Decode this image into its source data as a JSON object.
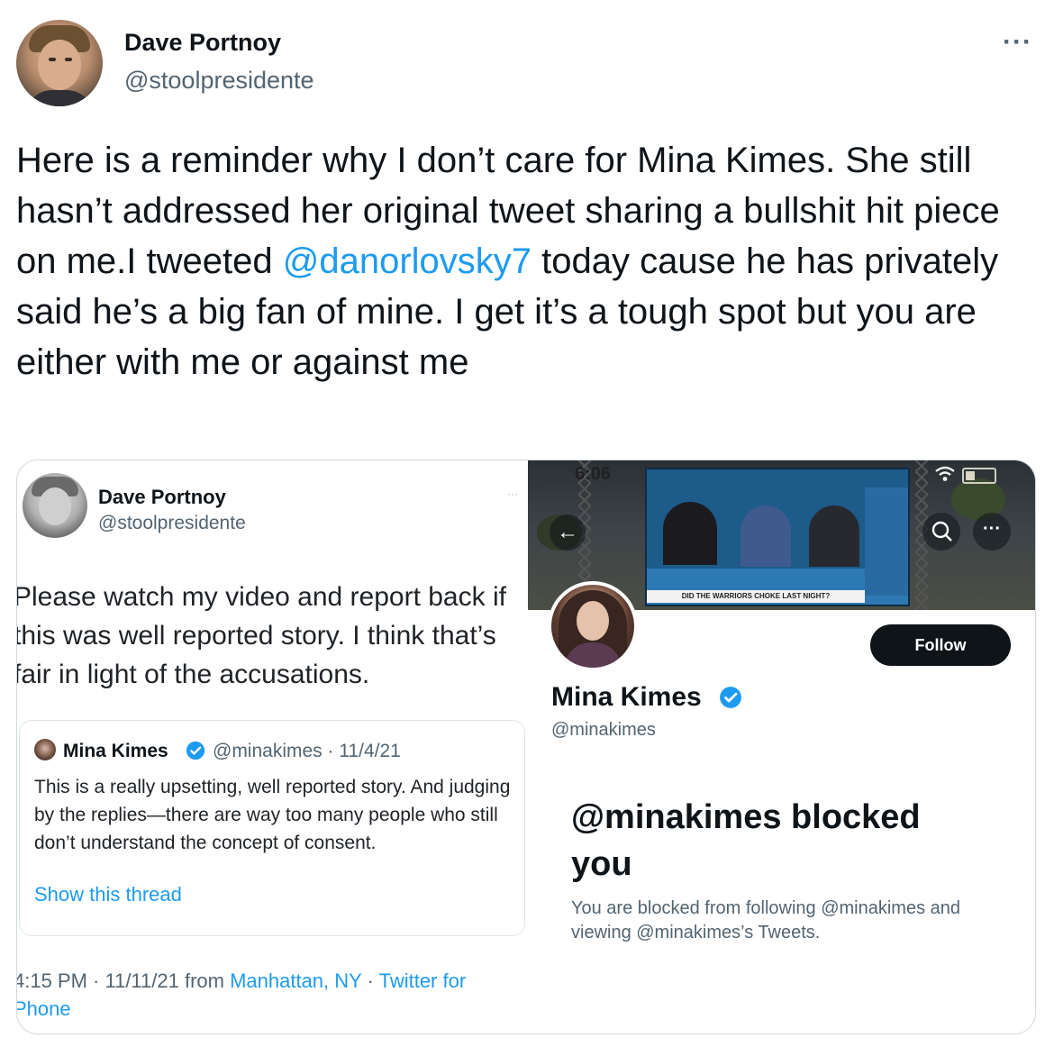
{
  "author": {
    "name": "Dave Portnoy",
    "handle": "@stoolpresidente",
    "more_label": "···"
  },
  "tweet": {
    "text_before": "Here is a reminder why I don’t care for Mina Kimes. She still hasn’t addressed her original tweet sharing a bullshit hit piece on me.I tweeted ",
    "mention": "@danorlovsky7",
    "text_after": " today cause he has privately said he’s a big fan of mine. I get it’s a tough spot but you are either with me or against me"
  },
  "screenshot_left": {
    "author_name": "Dave Portnoy",
    "author_handle": "@stoolpresidente",
    "more_label": "···",
    "text": "Please watch my video and report back if this was well reported story.  I think that’s fair in light of the accusations.",
    "quote": {
      "name": "Mina Kimes",
      "meta": "@minakimes · 11/4/21",
      "text": "This is a really upsetting, well reported story. And judging by the replies—there are way too many people who still don’t understand the concept of consent.",
      "link": "Show this thread"
    },
    "footer": {
      "time": "4:15 PM · 11/11/21 from ",
      "location": "Manhattan, NY",
      "sep": " · ",
      "client": "Twitter for Phone"
    }
  },
  "screenshot_right": {
    "status_time": "6:06",
    "banner_caption": "DID THE WARRIORS CHOKE LAST NIGHT?",
    "back_label": "←",
    "more_label": "···",
    "follow_label": "Follow",
    "name": "Mina Kimes",
    "handle": "@minakimes",
    "blocked_title": "@minakimes blocked you",
    "blocked_sub": "You are blocked from following @minakimes and viewing @minakimes’s Tweets."
  },
  "colors": {
    "accent": "#1d9bf0",
    "text": "#0f1419",
    "muted": "#536471",
    "border": "#cfd9de"
  }
}
